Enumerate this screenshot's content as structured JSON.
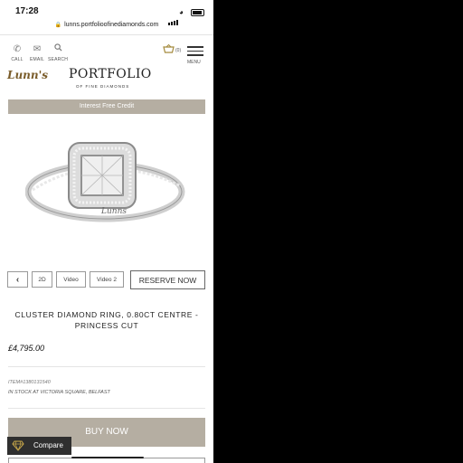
{
  "status_bar": {
    "time": "17:28"
  },
  "browser": {
    "url": "lunns.portfolioofinediamonds.com"
  },
  "header": {
    "nav": [
      {
        "label": "CALL",
        "icon": "phone-icon"
      },
      {
        "label": "EMAIL",
        "icon": "envelope-icon"
      },
      {
        "label": "SEARCH",
        "icon": "search-icon"
      }
    ],
    "cart_count": "(0)",
    "menu_label": "MENU",
    "brand_left": "Lunn's",
    "logo_text": "PORTFOLIO",
    "logo_sub": "OF FINE DIAMONDS"
  },
  "banner": {
    "text": "Interest Free Credit"
  },
  "gallery": {
    "tabs": [
      "2D",
      "Video",
      "Video 2"
    ],
    "reserve_label": "RESERVE NOW",
    "engraving": "Lunns"
  },
  "product": {
    "title": "CLUSTER DIAMOND RING, 0.80CT CENTRE - PRINCESS CUT",
    "price": "£4,795.00",
    "item_number": "ITEM#1380131540",
    "stock": "IN STOCK AT VICTORIA SQUARE, BELFAST"
  },
  "actions": {
    "buy_label": "BUY NOW",
    "compare_label": "Compare"
  },
  "colors": {
    "accent": "#b5aea2",
    "gold": "#a48a3c"
  }
}
